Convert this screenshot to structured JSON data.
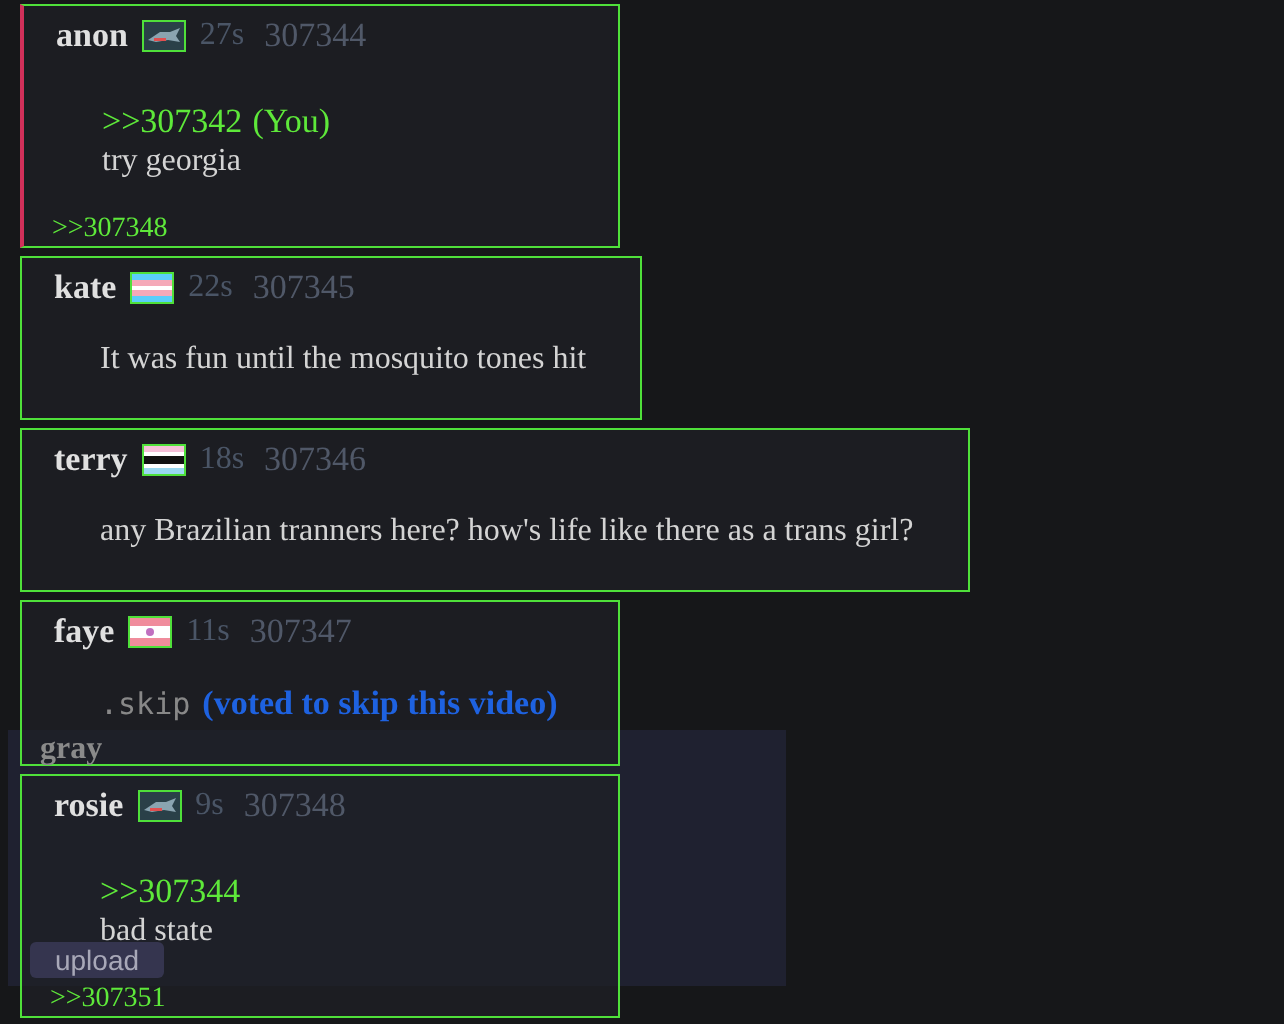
{
  "posts": [
    {
      "name": "anon",
      "flag": {
        "kind": "fish"
      },
      "time": "27s",
      "number": "307344",
      "highlighted": true,
      "quote": ">>307342",
      "you": "(You)",
      "body": "try georgia",
      "kind": "text",
      "backlinks": [
        ">>307348"
      ]
    },
    {
      "name": "kate",
      "flag": {
        "kind": "trans"
      },
      "time": "22s",
      "number": "307345",
      "highlighted": false,
      "body": "It was fun until the mosquito tones hit",
      "kind": "text"
    },
    {
      "name": "terry",
      "flag": {
        "kind": "stripes"
      },
      "time": "18s",
      "number": "307346",
      "highlighted": false,
      "body": "any Brazilian tranners here? how's life like there as a trans girl?",
      "kind": "text"
    },
    {
      "name": "faye",
      "flag": {
        "kind": "pink"
      },
      "time": "11s",
      "number": "307347",
      "highlighted": false,
      "body": ".skip",
      "note": "(voted to skip this video)",
      "kind": "command"
    },
    {
      "name": "rosie",
      "flag": {
        "kind": "fish"
      },
      "time": "9s",
      "number": "307348",
      "highlighted": false,
      "quote": ">>307344",
      "body": "bad state",
      "kind": "text",
      "backlinks": [
        ">>307351"
      ]
    }
  ],
  "panel": {
    "label": "gray",
    "button": "upload"
  }
}
